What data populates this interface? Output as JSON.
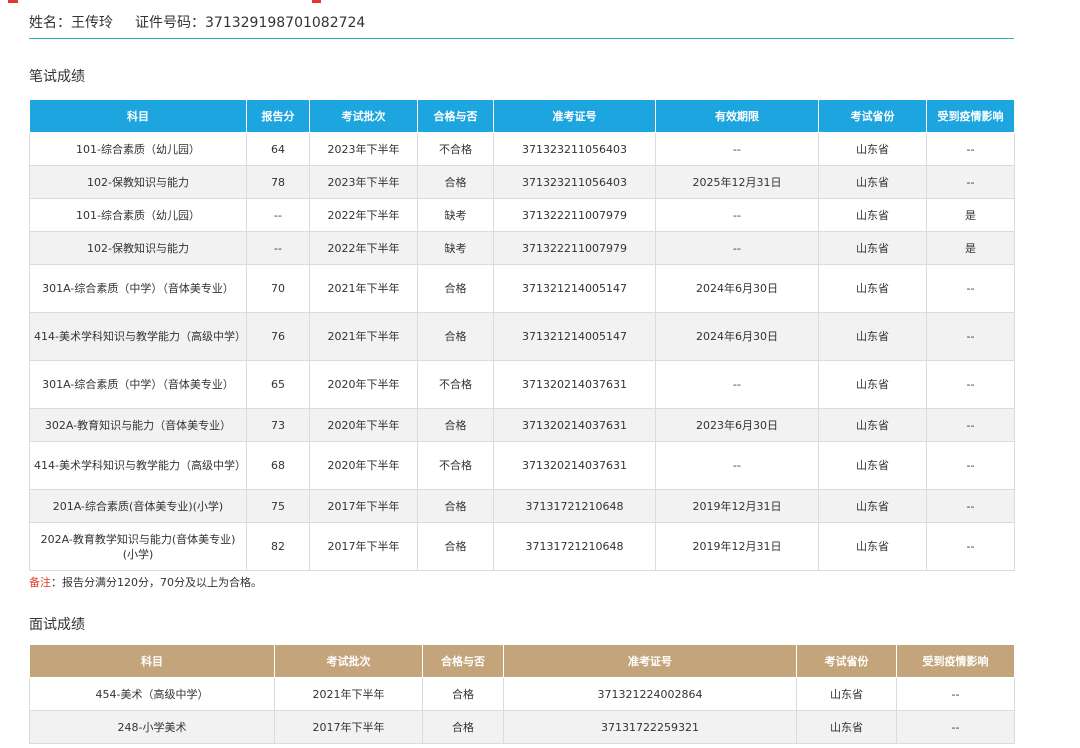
{
  "header": {
    "name_label": "姓名：",
    "name": "王传玲",
    "id_label": "证件号码：",
    "id_number": "371329198701082724"
  },
  "written": {
    "title": "笔试成绩",
    "columns": [
      "科目",
      "报告分",
      "考试批次",
      "合格与否",
      "准考证号",
      "有效期限",
      "考试省份",
      "受到疫情影响"
    ],
    "rows": [
      [
        "101-综合素质（幼儿园）",
        "64",
        "2023年下半年",
        "不合格",
        "371323211056403",
        "--",
        "山东省",
        "--"
      ],
      [
        "102-保教知识与能力",
        "78",
        "2023年下半年",
        "合格",
        "371323211056403",
        "2025年12月31日",
        "山东省",
        "--"
      ],
      [
        "101-综合素质（幼儿园）",
        "--",
        "2022年下半年",
        "缺考",
        "371322211007979",
        "--",
        "山东省",
        "是"
      ],
      [
        "102-保教知识与能力",
        "--",
        "2022年下半年",
        "缺考",
        "371322211007979",
        "--",
        "山东省",
        "是"
      ],
      [
        "301A-综合素质（中学）（音体美专业）",
        "70",
        "2021年下半年",
        "合格",
        "371321214005147",
        "2024年6月30日",
        "山东省",
        "--"
      ],
      [
        "414-美术学科知识与教学能力（高级中学）",
        "76",
        "2021年下半年",
        "合格",
        "371321214005147",
        "2024年6月30日",
        "山东省",
        "--"
      ],
      [
        "301A-综合素质（中学）（音体美专业）",
        "65",
        "2020年下半年",
        "不合格",
        "371320214037631",
        "--",
        "山东省",
        "--"
      ],
      [
        "302A-教育知识与能力（音体美专业）",
        "73",
        "2020年下半年",
        "合格",
        "371320214037631",
        "2023年6月30日",
        "山东省",
        "--"
      ],
      [
        "414-美术学科知识与教学能力（高级中学）",
        "68",
        "2020年下半年",
        "不合格",
        "371320214037631",
        "--",
        "山东省",
        "--"
      ],
      [
        "201A-综合素质(音体美专业)(小学)",
        "75",
        "2017年下半年",
        "合格",
        "37131721210648",
        "2019年12月31日",
        "山东省",
        "--"
      ],
      [
        "202A-教育教学知识与能力(音体美专业)(小学)",
        "82",
        "2017年下半年",
        "合格",
        "37131721210648",
        "2019年12月31日",
        "山东省",
        "--"
      ]
    ],
    "note_label": "备注",
    "note_text": "：报告分满分120分，70分及以上为合格。"
  },
  "interview": {
    "title": "面试成绩",
    "columns": [
      "科目",
      "考试批次",
      "合格与否",
      "准考证号",
      "考试省份",
      "受到疫情影响"
    ],
    "rows": [
      [
        "454-美术（高级中学）",
        "2021年下半年",
        "合格",
        "371321224002864",
        "山东省",
        "--"
      ],
      [
        "248-小学美术",
        "2017年下半年",
        "合格",
        "37131722259321",
        "山东省",
        "--"
      ]
    ]
  },
  "colors": {
    "written_header": "#1da5e0",
    "interview_header": "#c4a47a",
    "divider": "#2bb3ae",
    "note_label": "#e23b2e"
  }
}
